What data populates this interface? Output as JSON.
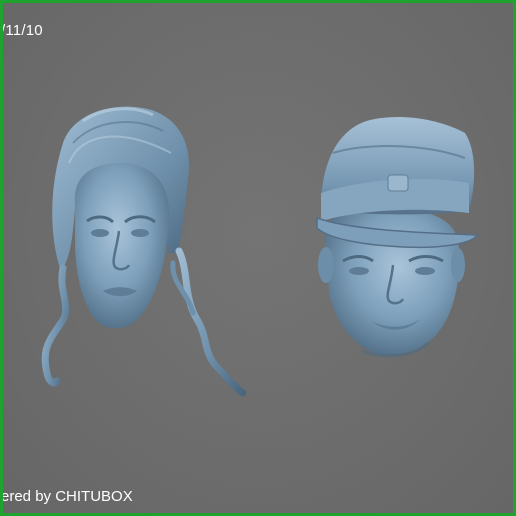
{
  "viewport": {
    "date_text": "/11/10",
    "footer_text": "ered by CHITUBOX",
    "border_color": "#1fa22e",
    "background_color": "#6e6e6e",
    "model_color": "#7a9db8"
  },
  "models": [
    {
      "label": "female-head-model"
    },
    {
      "label": "male-head-with-cap-model"
    }
  ]
}
